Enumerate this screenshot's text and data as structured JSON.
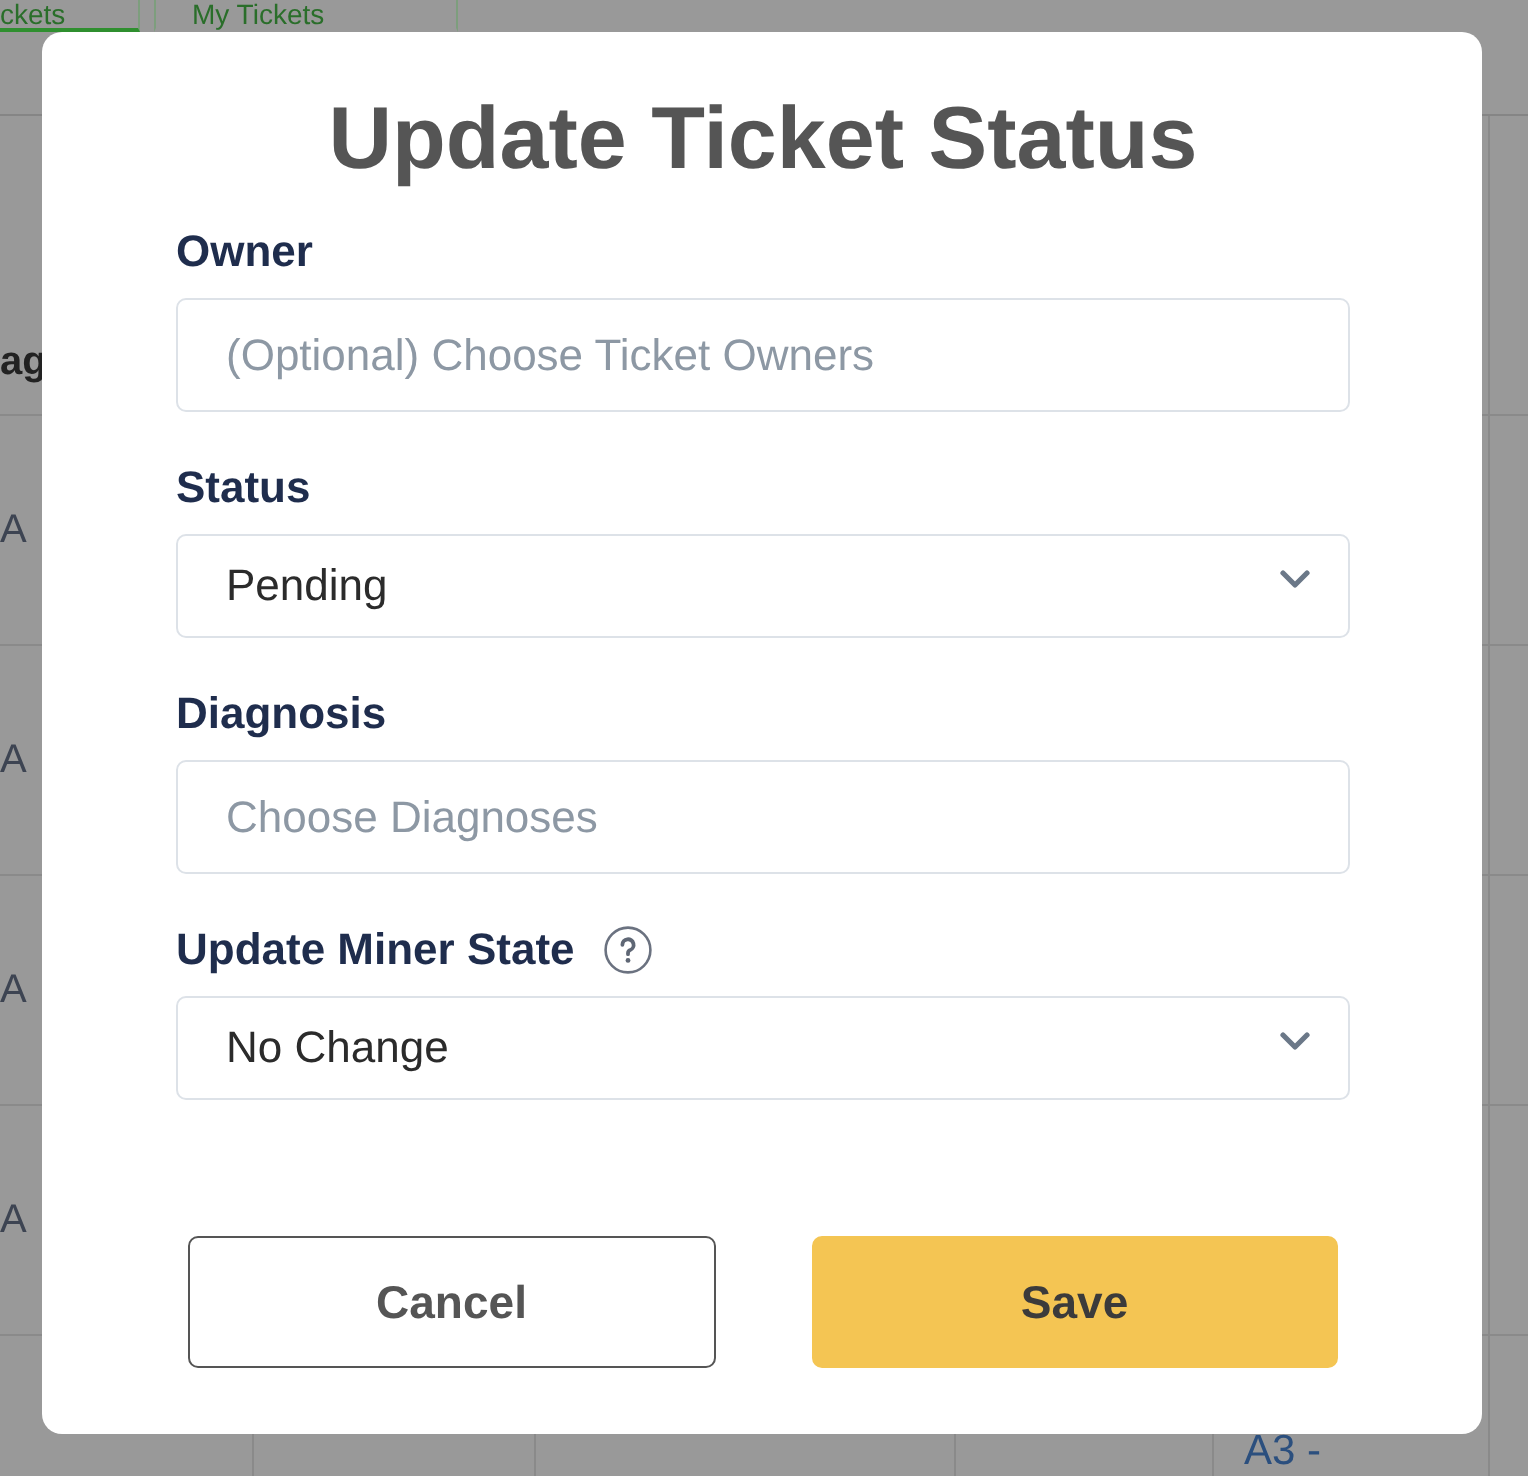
{
  "page": {
    "tabs": [
      {
        "label": "ckets",
        "selected": true
      },
      {
        "label": "My Tickets",
        "selected": false
      }
    ],
    "table": {
      "header": {
        "column_1": "ag"
      },
      "rows": [
        {
          "column_1": "A"
        },
        {
          "column_1": "A"
        },
        {
          "column_1": "A"
        },
        {
          "column_1": "A"
        },
        {
          "column_5": "A3 -"
        }
      ]
    }
  },
  "dialog": {
    "title": "Update Ticket Status",
    "fields": [
      {
        "kind": "text",
        "label": "Owner",
        "help": false,
        "placeholder": "(Optional) Choose Ticket Owners"
      },
      {
        "kind": "select",
        "label": "Status",
        "help": false,
        "value": "Pending"
      },
      {
        "kind": "text",
        "label": "Diagnosis",
        "help": false,
        "placeholder": "Choose Diagnoses"
      },
      {
        "kind": "select",
        "label": "Update Miner State",
        "help": true,
        "value": "No Change"
      }
    ],
    "buttons": [
      {
        "kind": "secondary",
        "label": "Cancel"
      },
      {
        "kind": "primary",
        "label": "Save"
      }
    ]
  }
}
